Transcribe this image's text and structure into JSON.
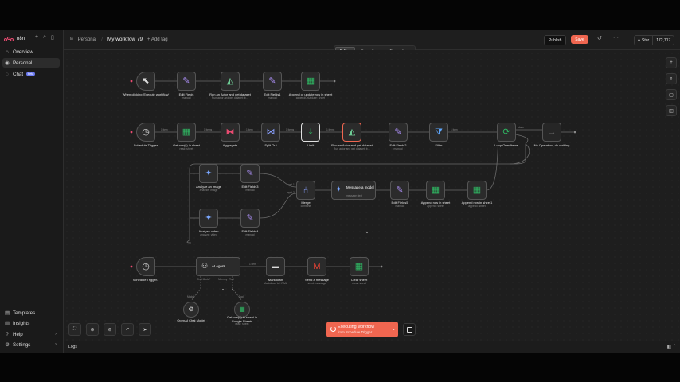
{
  "brand": {
    "name": "n8n",
    "accent": "#ea4b71"
  },
  "sidebar": {
    "top_icons": [
      "plus-icon",
      "search-icon",
      "layout-icon"
    ],
    "items": [
      {
        "label": "Overview",
        "icon": "home-icon"
      },
      {
        "label": "Personal",
        "icon": "user-icon"
      },
      {
        "label": "Chat",
        "icon": "chat-icon",
        "badge": "beta"
      }
    ],
    "bottom_items": [
      {
        "label": "Templates",
        "icon": "template-icon"
      },
      {
        "label": "Insights",
        "icon": "chart-icon"
      },
      {
        "label": "Help",
        "icon": "help-icon"
      },
      {
        "label": "Settings",
        "icon": "gear-icon"
      }
    ]
  },
  "header": {
    "project": "Personal",
    "workflow_name": "My workflow 79",
    "add_tag": "+ Add tag",
    "publish": "Publish",
    "save": "Save",
    "star_label": "Star",
    "star_count": "172,717"
  },
  "tabs": [
    {
      "label": "Editor",
      "active": true
    },
    {
      "label": "Executions",
      "active": false
    },
    {
      "label": "Evaluations",
      "active": false
    }
  ],
  "nodes": {
    "manual_trigger": {
      "label": "When clicking 'Execute workflow'",
      "icon": "cursor-icon"
    },
    "edit_fields": {
      "label": "Edit Fields",
      "sub": "manual",
      "icon": "pencil-icon"
    },
    "run_actor_1": {
      "label": "Run an Actor and get dataset",
      "sub": "Run actor and get dataset: b…",
      "icon": "apify-icon"
    },
    "edit_fields1": {
      "label": "Edit Fields1",
      "sub": "manual",
      "icon": "pencil-icon"
    },
    "append_row_top": {
      "label": "Append or update row in sheet",
      "sub": "appendOrUpdate: sheet",
      "icon": "sheets-icon"
    },
    "schedule_trigger": {
      "label": "Schedule Trigger",
      "icon": "clock-icon"
    },
    "get_rows": {
      "label": "Get row(s) in sheet",
      "sub": "read: sheet",
      "icon": "sheets-icon"
    },
    "aggregate": {
      "label": "Aggregate",
      "icon": "aggregate-icon"
    },
    "split_out": {
      "label": "Split Out",
      "icon": "split-icon"
    },
    "limit": {
      "label": "Limit",
      "icon": "limit-icon"
    },
    "run_actor_2": {
      "label": "Run an Actor and get dataset",
      "sub": "Run actor and get dataset: b…",
      "icon": "apify-icon"
    },
    "edit_fields2": {
      "label": "Edit Fields2",
      "sub": "manual",
      "icon": "pencil-icon"
    },
    "filter": {
      "label": "Filter",
      "icon": "filter-icon"
    },
    "loop_over_items": {
      "label": "Loop Over Items",
      "icon": "loop-icon"
    },
    "no_operation": {
      "label": "No Operation, do nothing",
      "icon": "arrow-icon"
    },
    "analyze_image": {
      "label": "Analyze an image",
      "sub": "analyze: image",
      "icon": "gemini-icon"
    },
    "edit_fields3": {
      "label": "Edit Fields3",
      "sub": "manual",
      "icon": "pencil-icon"
    },
    "analyze_video": {
      "label": "Analyze video",
      "sub": "analyze: video",
      "icon": "gemini-icon"
    },
    "edit_fields4": {
      "label": "Edit Fields4",
      "sub": "manual",
      "icon": "pencil-icon"
    },
    "merge": {
      "label": "Merge",
      "sub": "combine",
      "icon": "merge-icon",
      "inputs": [
        "Input 1",
        "Input 2"
      ]
    },
    "message_model": {
      "label": "Message a model",
      "sub": "message: text",
      "icon": "gemini-icon"
    },
    "edit_fields5": {
      "label": "Edit Fields5",
      "sub": "manual",
      "icon": "pencil-icon"
    },
    "append_row_sheet": {
      "label": "Append row in sheet",
      "sub": "append: sheet",
      "icon": "sheets-icon"
    },
    "append_row_sheet1": {
      "label": "Append row in sheet1",
      "sub": "append: sheet",
      "icon": "sheets-icon"
    },
    "schedule_trigger1": {
      "label": "Schedule Trigger1",
      "icon": "clock-icon"
    },
    "ai_agent": {
      "label": "AI Agent",
      "icon": "robot-icon",
      "ports": [
        "Chat Model*",
        "Memory",
        "Tool"
      ]
    },
    "markdown": {
      "label": "Markdown",
      "sub": "Markdown to HTML",
      "icon": "markdown-icon"
    },
    "send_message": {
      "label": "Send a message",
      "sub": "send: message",
      "icon": "gmail-icon"
    },
    "clear_sheet": {
      "label": "Clear sheet",
      "sub": "clear: sheet",
      "icon": "sheets-icon"
    },
    "openai_model": {
      "label": "OpenAI Chat Model",
      "icon": "openai-icon",
      "port": "Model"
    },
    "get_rows_tool": {
      "label": "Get row(s) in sheet in Google Sheets",
      "sub": "read: sheet",
      "icon": "sheets-icon",
      "port": "Tool"
    }
  },
  "wire_labels": {
    "sched_get": "1 item",
    "get_agg": "1 items",
    "agg_split": "1 item",
    "split_limit": "1 items",
    "limit_actor": "1 items",
    "filter_loop": "1 item",
    "loop_noop": "done",
    "agent_md": "1 item"
  },
  "execution": {
    "title": "Executing workflow",
    "subtitle": "from Schedule Trigger"
  },
  "logs": {
    "label": "Logs"
  }
}
